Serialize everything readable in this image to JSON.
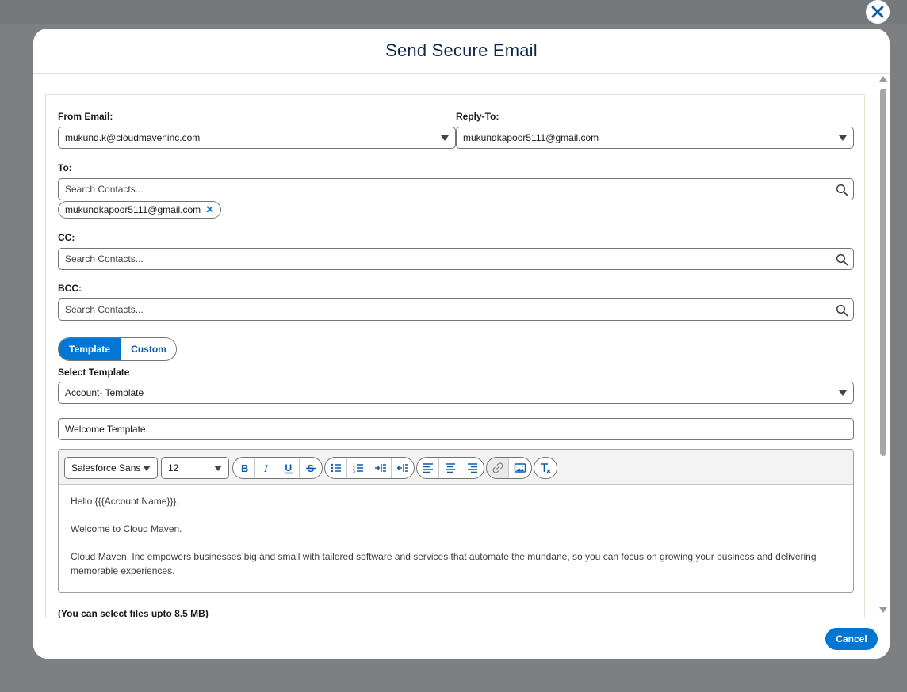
{
  "modal": {
    "title": "Send Secure Email"
  },
  "from": {
    "label": "From Email:",
    "value": "mukund.k@cloudmaveninc.com"
  },
  "reply_to": {
    "label": "Reply-To:",
    "value": "mukundkapoor5111@gmail.com"
  },
  "to": {
    "label": "To:",
    "placeholder": "Search Contacts...",
    "recipients": [
      "mukundkapoor5111@gmail.com"
    ]
  },
  "cc": {
    "label": "CC:",
    "placeholder": "Search Contacts..."
  },
  "bcc": {
    "label": "BCC:",
    "placeholder": "Search Contacts..."
  },
  "mode_toggle": {
    "template_label": "Template",
    "custom_label": "Custom",
    "active": "Template"
  },
  "template": {
    "label": "Select Template",
    "selected": "Account- Template",
    "subject": "Welcome Template"
  },
  "editor": {
    "font_family": "Salesforce Sans",
    "font_size": "12",
    "body": [
      "Hello {{{Account.Name}}},",
      "Welcome to Cloud Maven.",
      "Cloud Maven, Inc empowers businesses big and small with tailored software and services that automate the mundane, so you can focus on growing your business and delivering memorable experiences."
    ]
  },
  "attachments": {
    "note": "(You can select files upto 8.5 MB)"
  },
  "footer": {
    "cancel_label": "Cancel"
  },
  "colors": {
    "brand": "#0176d3",
    "title": "#0b2a4a"
  }
}
